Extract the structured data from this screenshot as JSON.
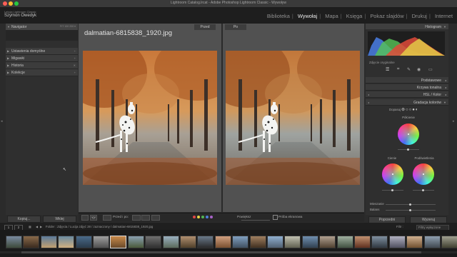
{
  "window": {
    "title": "Lightroom Catalog.lrcat - Adobe Photoshop Lightroom Classic - Wywoływ"
  },
  "identity": {
    "small_text": "Lekcja Lightroom Classic",
    "name": "Szymon Owedyk"
  },
  "modules": [
    {
      "label": "Biblioteka",
      "active": false
    },
    {
      "label": "Wywołaj",
      "active": true
    },
    {
      "label": "Mapa",
      "active": false
    },
    {
      "label": "Księga",
      "active": false
    },
    {
      "label": "Pokaz slajdów",
      "active": false
    },
    {
      "label": "Drukuj",
      "active": false
    },
    {
      "label": "Internet",
      "active": false
    }
  ],
  "left_panel": {
    "sections": [
      {
        "label": "Navigator",
        "chev": "FIT  100  200  ▾"
      },
      {
        "label": "Ustawienia domyślne",
        "chev": "+"
      },
      {
        "label": "Migawki",
        "chev": "+"
      },
      {
        "label": "Historia",
        "chev": "✕"
      },
      {
        "label": "Kolekcje",
        "chev": "+"
      }
    ],
    "copy_button": "Kopiuj...",
    "paste_button": "Wklej"
  },
  "center": {
    "filename": "dalmatian-6815838_1920.jpg",
    "before_label": "Przed",
    "after_label": "Po"
  },
  "toolbar": {
    "view_label": "Przed i po:",
    "soft_proof": "Próba ekranowa",
    "zoom_text": "Powiększ"
  },
  "right_panel": {
    "histogram_label": "Histogram",
    "histogram_caption": "Zdjęcie oryginalne",
    "sections": [
      {
        "label": "Podstawowe"
      },
      {
        "label": "Krzywa tonalna"
      },
      {
        "label": "HSL / Kolor"
      },
      {
        "label": "Gradacja kolorów"
      }
    ],
    "adjust_label": "Dopasuj",
    "midtones_label": "Półcienie",
    "shadows_label": "Cienie",
    "highlights_label": "Podświetlenia",
    "blend_label": "Mieszanie",
    "balance_label": "Balans",
    "previous_button": "Poprzedni",
    "reset_button": "Wyzeruj"
  },
  "filmstrip": {
    "page1": "1",
    "page2": "2",
    "path": "Folder : Zdjęcia / Lucija zdjęć 28 / zaznaczony / dalmatian-6815838_1920.jpg",
    "filter_label": "Filtr :",
    "filter_value": "Filtry wyłączone",
    "thumb_count": 26,
    "selected_index": 6
  },
  "colors": {
    "accent_label": "#ffffff",
    "bg_panel": "#2f2f2f",
    "bg_center": "#515151"
  }
}
